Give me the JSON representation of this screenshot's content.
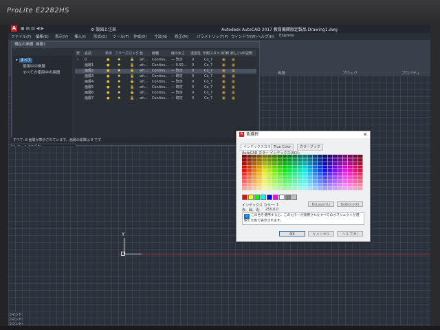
{
  "monitor": {
    "brand": "ProLite E2282HS"
  },
  "app": {
    "icon_letter": "A",
    "quick_access": "▣ ▤ ▥ ◀ ▶",
    "workspace": "⚙ 製図と注釈",
    "document_title": "Autodesk AutoCAD 2017  教育機関限定製品  Drawing1.dwg"
  },
  "menu": [
    "ファイル(F)",
    "編集(E)",
    "表示(V)",
    "挿入(I)",
    "形式(O)",
    "ツール(T)",
    "作成(D)",
    "寸法(N)",
    "修正(M)",
    "パラメトリック(P)",
    "ウィンドウ(W)",
    "ヘルプ(H)",
    "Express"
  ],
  "ribbon_panels": {
    "a": "画層",
    "b": "ブロック",
    "c": "プロパティ"
  },
  "layer_palette": {
    "title": "現在の画層: 画層1",
    "filters": {
      "root": "すべて",
      "used": "使用中の画層",
      "xref": "すべての使用中の画層"
    },
    "columns": [
      "状",
      "名前",
      "表示",
      "フリーズ",
      "ロック",
      "色",
      "線種",
      "線の太さ",
      "透過性",
      "印刷スタイル",
      "印刷",
      "新しいVP",
      "説明"
    ],
    "rows": [
      {
        "status": "✓",
        "name": "0",
        "color": "wh...",
        "linetype": "Continu...",
        "lw": "— 既定",
        "tr": "0",
        "ps": "Co_7",
        "hl": false
      },
      {
        "status": "",
        "name": "画層1",
        "color": "wh...",
        "linetype": "Continu...",
        "lw": "— 0.50...",
        "tr": "0",
        "ps": "Co_7",
        "hl": false
      },
      {
        "status": "",
        "name": "画層2",
        "color": "wh...",
        "linetype": "Continu...",
        "lw": "— 既定",
        "tr": "0",
        "ps": "Co_7",
        "hl": true
      },
      {
        "status": "",
        "name": "画層3",
        "color": "wh...",
        "linetype": "Continu...",
        "lw": "— 既定",
        "tr": "0",
        "ps": "Co_7",
        "hl": false
      },
      {
        "status": "",
        "name": "画層4",
        "color": "wh...",
        "linetype": "Continu...",
        "lw": "— 既定",
        "tr": "0",
        "ps": "Co_7",
        "hl": false
      },
      {
        "status": "",
        "name": "画層5",
        "color": "wh...",
        "linetype": "Continu...",
        "lw": "— 既定",
        "tr": "0",
        "ps": "Co_7",
        "hl": false
      },
      {
        "status": "",
        "name": "画層6",
        "color": "wh...",
        "linetype": "Continu...",
        "lw": "— 既定",
        "tr": "0",
        "ps": "Co_7",
        "hl": false
      },
      {
        "status": "",
        "name": "画層7",
        "color": "wh...",
        "linetype": "Continu...",
        "lw": "— 既定",
        "tr": "0",
        "ps": "Co_7",
        "hl": false
      }
    ],
    "search_text": "フィルタを反転",
    "status_line": "すべて: 8 画層が表示されています。画層の総数は 8 です"
  },
  "dialog": {
    "title": "色選択",
    "close": "✕",
    "tabs": [
      "インデックスカラー",
      "True Color",
      "カラーブック"
    ],
    "subtitle": "AutoCAD カラー インデックス(ACI):",
    "index_label": "インデックス カラー:",
    "index_value": "1",
    "rgb_label": "赤、緑、青:",
    "rgb_value": "255,0,0",
    "bylayer": "ByLayer(L)",
    "byblock": "ByBlock(K)",
    "color_label": "色(C):",
    "color_value": "red",
    "info": "この色を使用すると、このカラーが適用されたすべてのオブジェクトが選択した色で表示されます。",
    "ok": "OK",
    "cancel": "キャンセル",
    "help": "ヘルプ(H)",
    "standard_colors": [
      "#ff0000",
      "#ffff00",
      "#00ff00",
      "#00ffff",
      "#0000ff",
      "#ff00ff",
      "#ffffff",
      "#808080",
      "#c0c0c0"
    ]
  },
  "canvas": {
    "ucs_y": "Y"
  },
  "command_history": [
    "コマンド:",
    "コマンド:",
    "コマンド:"
  ]
}
